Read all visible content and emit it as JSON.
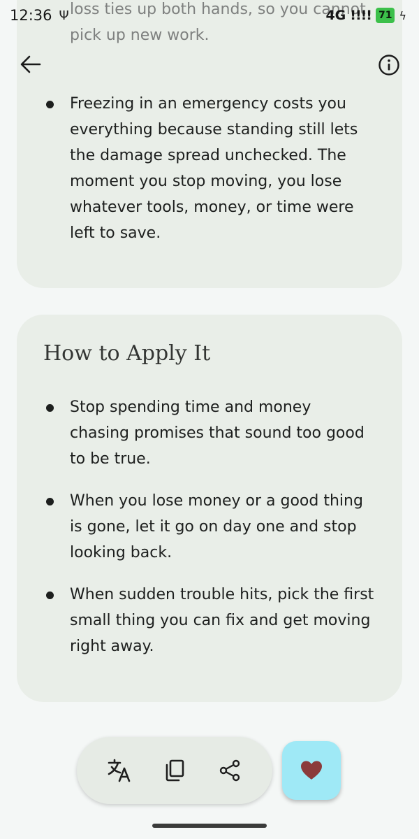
{
  "status_bar": {
    "time": "12:36",
    "usb": "Ψ",
    "network": "4G",
    "signal": "!!!!",
    "battery": "71",
    "bolt": "ϟ"
  },
  "top_card": {
    "faded_lines": "back a single cent. Holding onto an old loss ties up both hands, so you cannot pick up new work.",
    "bullets": [
      "Freezing in an emergency costs you everything because standing still lets the damage spread unchecked. The moment you stop moving, you lose whatever tools, money, or time were left to save."
    ]
  },
  "apply_card": {
    "title": "How to Apply It",
    "bullets": [
      "Stop spending time and money chasing promises that sound too good to be true.",
      "When you lose money or a good thing is gone, let it go on day one and stop looking back.",
      "When sudden trouble hits, pick the first small thing you can fix and get moving right away."
    ]
  },
  "icons": {
    "back": "arrow-back-icon",
    "info": "info-icon",
    "translate": "translate-icon",
    "copy": "copy-icon",
    "share": "share-icon",
    "favorite": "heart-icon"
  },
  "colors": {
    "card": "#e9eee8",
    "favorite_bg": "#9fe9f6",
    "heart": "#8b3b3b",
    "battery": "#3cc04a"
  }
}
